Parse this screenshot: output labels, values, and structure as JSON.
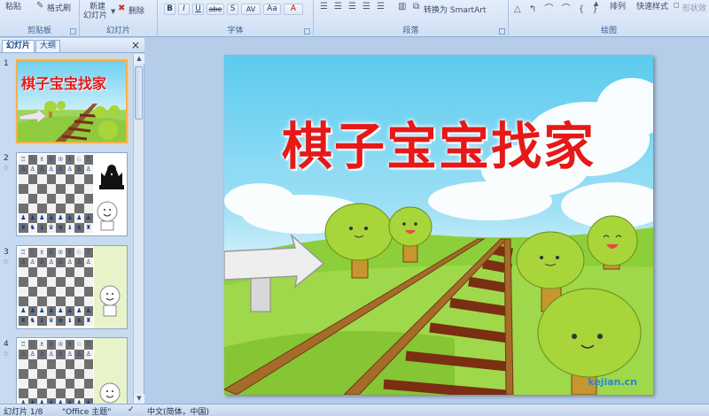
{
  "ribbon": {
    "clipboard": {
      "paste_label": "粘贴",
      "format_painter_label": "格式刷",
      "group_title": "剪贴板"
    },
    "slides": {
      "new_slide_label": "新建",
      "new_slide_label2": "幻灯片",
      "delete_label": "删除",
      "group_title": "幻灯片"
    },
    "font": {
      "group_title": "字体",
      "bold": "B",
      "italic": "I",
      "underline": "U",
      "strike": "abe",
      "shadow": "S",
      "spacing": "AV",
      "case": "Aa",
      "color": "A"
    },
    "paragraph": {
      "group_title": "段落",
      "smartart_label": "转换为 SmartArt"
    },
    "drawing": {
      "group_title": "绘图",
      "arrange_label": "排列",
      "quick_styles_label": "快速样式",
      "shape_effects_label": "形状效"
    }
  },
  "left_pane": {
    "tabs": [
      {
        "label": "幻灯片"
      },
      {
        "label": "大纲"
      }
    ],
    "close_label": "×",
    "thumb_title": "棋子宝宝找家",
    "slide_numbers": [
      "1",
      "2",
      "3",
      "4"
    ],
    "star_glyph": "☆"
  },
  "slide": {
    "title": "棋子宝宝找家",
    "watermark": "kejian.cn"
  },
  "statusbar": {
    "slide_counter": "幻灯片 1/8",
    "theme": "\"Office 主题\"",
    "language": "中文(简体，中国)"
  },
  "colors": {
    "title_red": "#e61818",
    "sky": "#5bcbee",
    "grass": "#8ccf3a",
    "rail_brown": "#7a2e12"
  }
}
